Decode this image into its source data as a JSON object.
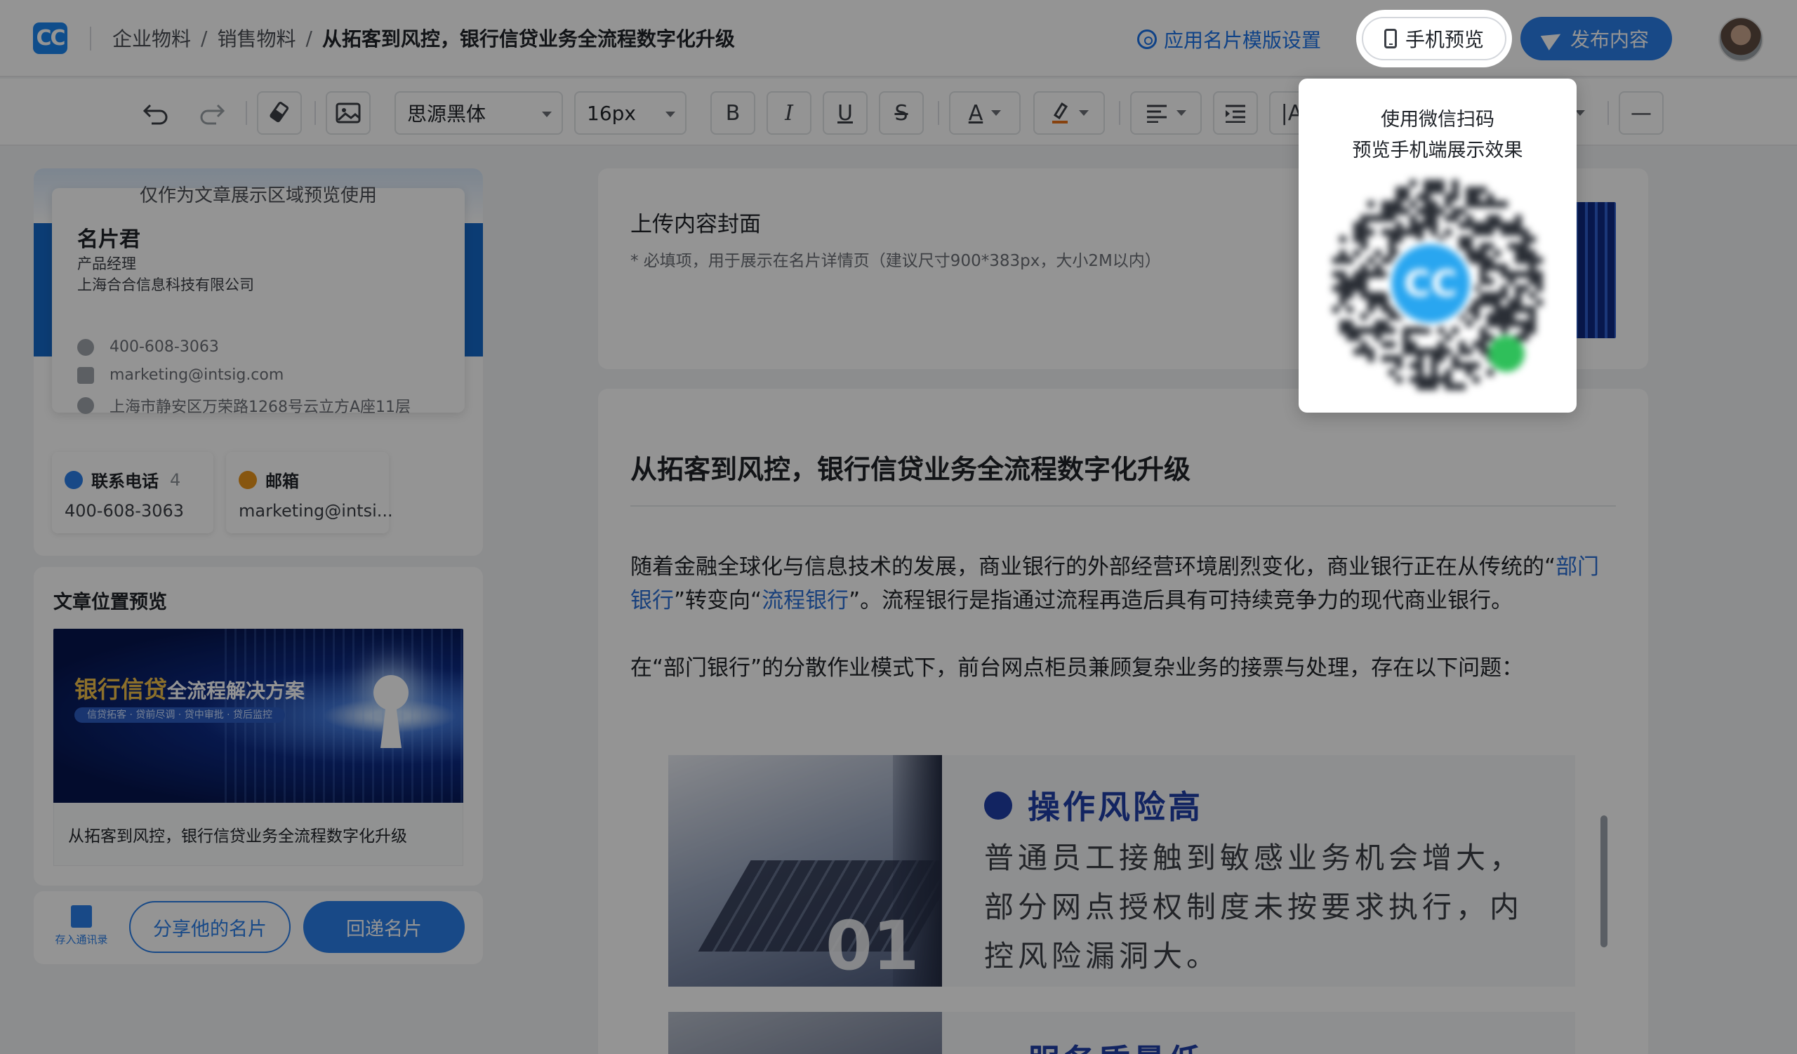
{
  "header": {
    "logo_text": "CC",
    "breadcrumb": [
      "企业物料",
      "销售物料",
      "从拓客到风控，银行信贷业务全流程数字化升级"
    ],
    "separator": "/",
    "template_setting_label": "应用名片模版设置",
    "mobile_preview_label": "手机预览",
    "publish_label": "发布内容"
  },
  "toolbar": {
    "font_family": "思源黑体",
    "font_size": "16px",
    "bold_glyph": "B",
    "italic_glyph": "I",
    "underline_glyph": "U",
    "strike_glyph": "S",
    "text_color_glyph": "A",
    "extra_glyph": "|A",
    "divider_glyph": "—"
  },
  "card_preview": {
    "note": "仅作为文章展示区域预览使用",
    "name": "名片君",
    "title": "产品经理",
    "company": "上海合合信息科技有限公司",
    "phone": "400-608-3063",
    "email": "marketing@intsig.com",
    "address": "上海市静安区万荣路1268号云立方A座11层",
    "contact_phone_label": "联系电话",
    "contact_phone_count": "4",
    "contact_phone_value": "400-608-3063",
    "contact_email_label": "邮箱",
    "contact_email_value": "marketing@intsi..."
  },
  "article_preview": {
    "heading": "文章位置预览",
    "banner_main": "银行信贷",
    "banner_main_rest": "全流程解决方案",
    "banner_sub": "信贷拓客 · 贷前尽调 · 贷中审批 · 贷后监控",
    "caption": "从拓客到风控，银行信贷业务全流程数字化升级"
  },
  "footer": {
    "save_contact_label": "存入通讯录",
    "share_label": "分享他的名片",
    "reply_label": "回递名片"
  },
  "cover": {
    "title": "上传内容封面",
    "hint": "* 必填项，用于展示在名片详情页（建议尺寸900*383px，大小2M以内）"
  },
  "article": {
    "title": "从拓客到风控，银行信贷业务全流程数字化升级",
    "p1_a": "随着金融全球化与信息技术的发展，商业银行的外部经营环境剧烈变化，商业银行正在从传统的“",
    "p1_link1": "部门银行",
    "p1_b": "”转变向“",
    "p1_link2": "流程银行",
    "p1_c": "”。流程银行是指通过流程再造后具有可持续竞争力的现代商业银行。",
    "p2": "在“部门银行”的分散作业模式下，前台网点柜员兼顾复杂业务的接票与处理，存在以下问题：",
    "block1_number": "01",
    "block1_title": "操作风险高",
    "block1_text": "普通员工接触到敏感业务机会增大，部分网点授权制度未按要求执行，内控风险漏洞大。",
    "block2_title": "服务质量低"
  },
  "popover": {
    "line1": "使用微信扫码",
    "line2": "预览手机端展示效果",
    "qr_logo": "CC"
  },
  "icons": {
    "undo": "undo-icon",
    "redo": "redo-icon",
    "eraser": "eraser-icon",
    "image": "image-icon",
    "align": "align-left-icon",
    "indent": "indent-icon",
    "phone": "phone-icon",
    "mail": "mail-icon",
    "location": "location-icon",
    "gear": "gear-icon",
    "send": "send-icon"
  },
  "colors": {
    "accent": "#2a7ee8",
    "link": "#2a6fd6",
    "risk_title": "#1f3fa8",
    "overlay": "rgba(0,0,0,0.42)"
  }
}
